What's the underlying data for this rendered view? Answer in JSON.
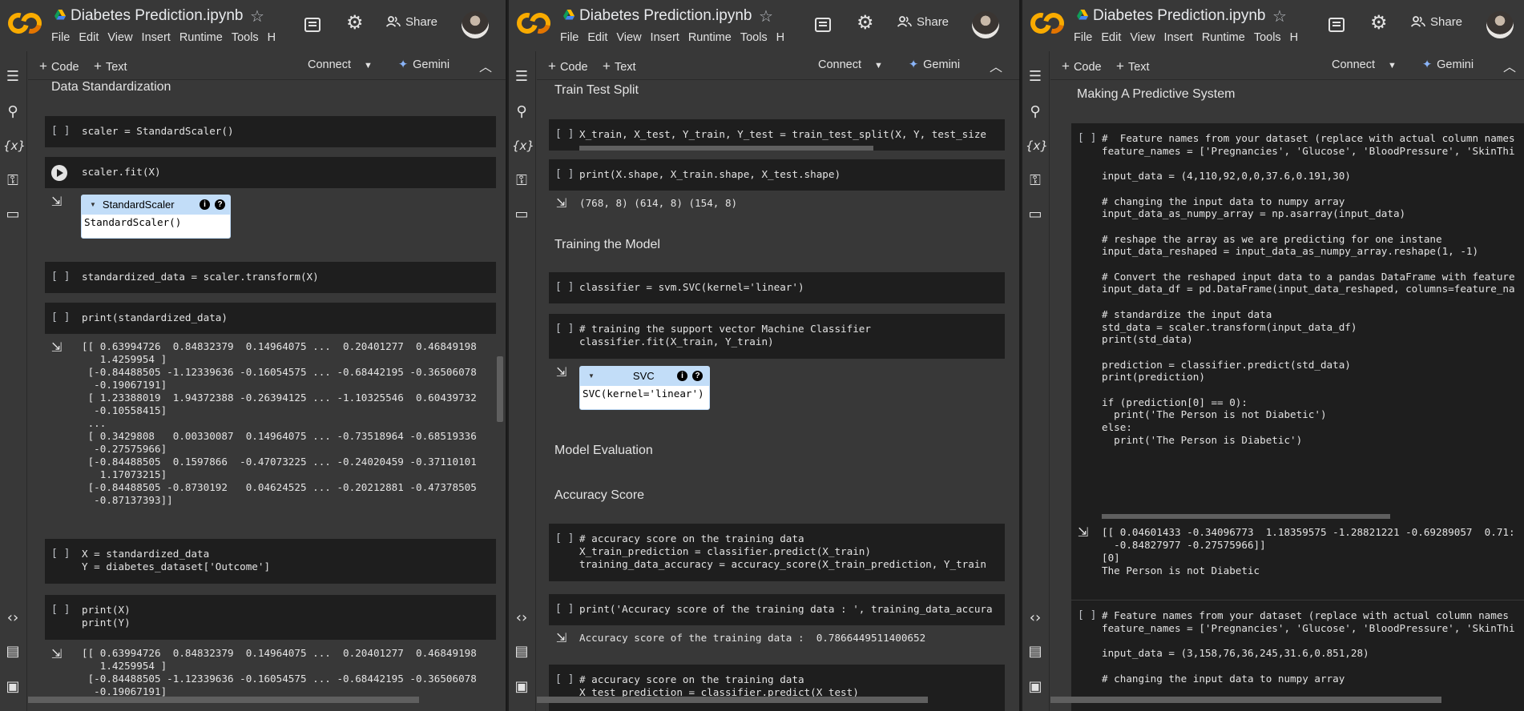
{
  "notebook": {
    "title": "Diabetes Prediction.ipynb",
    "menu": [
      "File",
      "Edit",
      "View",
      "Insert",
      "Runtime",
      "Tools",
      "H"
    ],
    "share_label": "Share",
    "toolbar": {
      "code_label": "Code",
      "text_label": "Text",
      "connect_label": "Connect",
      "gemini_label": "Gemini"
    }
  },
  "panel1": {
    "heading_standardization": "Data Standardization",
    "cell_scaler": "scaler = StandardScaler()",
    "cell_fit": "scaler.fit(X)",
    "widget_title": "StandardScaler",
    "widget_body": "StandardScaler()",
    "cell_transform": "standardized_data = scaler.transform(X)",
    "cell_print": "print(standardized_data)",
    "output_standardized": "[[ 0.63994726  0.84832379  0.14964075 ...  0.20401277  0.46849198\n   1.4259954 ]\n [-0.84488505 -1.12339636 -0.16054575 ... -0.68442195 -0.36506078\n  -0.19067191]\n [ 1.23388019  1.94372388 -0.26394125 ... -1.10325546  0.60439732\n  -0.10558415]\n ...\n [ 0.3429808   0.00330087  0.14964075 ... -0.73518964 -0.68519336\n  -0.27575966]\n [-0.84488505  0.1597866  -0.47073225 ... -0.24020459 -0.37110101\n   1.17073215]\n [-0.84488505 -0.8730192   0.04624525 ... -0.20212881 -0.47378505\n  -0.87137393]]",
    "cell_xy": "X = standardized_data\nY = diabetes_dataset['Outcome']",
    "cell_print_xy": "print(X)\nprint(Y)",
    "output_xy": "[[ 0.63994726  0.84832379  0.14964075 ...  0.20401277  0.46849198\n   1.4259954 ]\n [-0.84488505 -1.12339636 -0.16054575 ... -0.68442195 -0.36506078\n  -0.19067191]"
  },
  "panel2": {
    "heading_split": "Train Test Split",
    "cell_split": "X_train, X_test, Y_train, Y_test = train_test_split(X, Y, test_size",
    "cell_shape": "print(X.shape, X_train.shape, X_test.shape)",
    "output_shape": "(768, 8) (614, 8) (154, 8)",
    "heading_training": "Training the Model",
    "cell_classifier": "classifier = svm.SVC(kernel='linear')",
    "cell_fit": "# training the support vector Machine Classifier\nclassifier.fit(X_train, Y_train)",
    "widget_title": "SVC",
    "widget_body": "SVC(kernel='linear')",
    "heading_eval": "Model Evaluation",
    "heading_accuracy": "Accuracy Score",
    "cell_acc_train": "# accuracy score on the training data\nX_train_prediction = classifier.predict(X_train)\ntraining_data_accuracy = accuracy_score(X_train_prediction, Y_train",
    "cell_print_acc": "print('Accuracy score of the training data : ', training_data_accura",
    "output_acc": "Accuracy score of the training data :  0.7866449511400652",
    "cell_acc_test": "# accuracy score on the training data\nX_test_prediction = classifier.predict(X_test)"
  },
  "panel3": {
    "heading_predictive": "Making A Predictive System",
    "cell_predict_1": "#  Feature names from your dataset (replace with actual column names\nfeature_names = ['Pregnancies', 'Glucose', 'BloodPressure', 'SkinThi\n\ninput_data = (4,110,92,0,0,37.6,0.191,30)\n\n# changing the input data to numpy array\ninput_data_as_numpy_array = np.asarray(input_data)\n\n# reshape the array as we are predicting for one instane\ninput_data_reshaped = input_data_as_numpy_array.reshape(1, -1)\n\n# Convert the reshaped input data to a pandas DataFrame with feature\ninput_data_df = pd.DataFrame(input_data_reshaped, columns=feature_na\n\n# standardize the input data\nstd_data = scaler.transform(input_data_df)\nprint(std_data)\n\nprediction = classifier.predict(std_data)\nprint(prediction)\n\nif (prediction[0] == 0):\n  print('The Person is not Diabetic')\nelse:\n  print('The Person is Diabetic')",
    "output_predict_1": "[[ 0.04601433 -0.34096773  1.18359575 -1.28821221 -0.69289057  0.71:\n  -0.84827977 -0.27575966]]\n[0]\nThe Person is not Diabetic",
    "cell_predict_2": "# Feature names from your dataset (replace with actual column names\nfeature_names = ['Pregnancies', 'Glucose', 'BloodPressure', 'SkinThi\n\ninput_data = (3,158,76,36,245,31.6,0.851,28)\n\n# changing the input data to numpy array"
  },
  "colors": {
    "background": "#383838",
    "cell": "#1e1e1e",
    "accent_logo": "#f9ab00",
    "widget_header": "#c2ddf8"
  }
}
